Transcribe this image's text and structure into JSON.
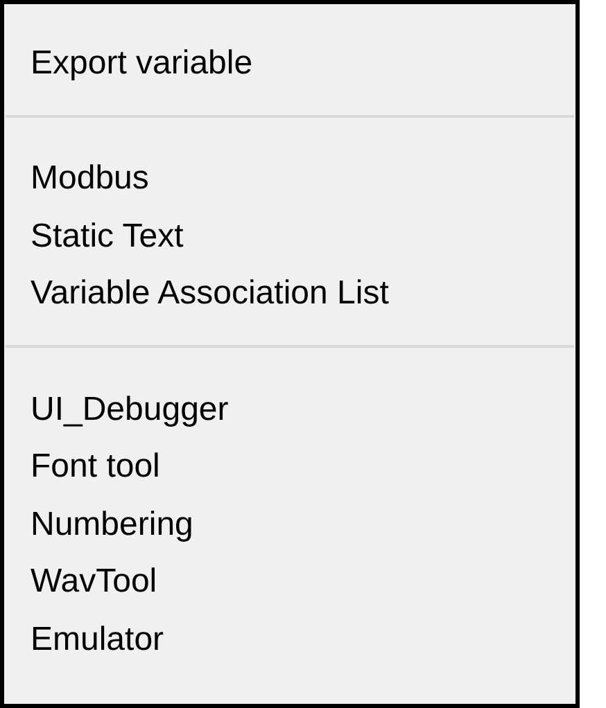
{
  "menu": {
    "groups": [
      {
        "items": [
          {
            "label": "Export variable"
          }
        ]
      },
      {
        "items": [
          {
            "label": "Modbus"
          },
          {
            "label": "Static Text"
          },
          {
            "label": "Variable Association List"
          }
        ]
      },
      {
        "items": [
          {
            "label": "UI_Debugger"
          },
          {
            "label": "Font tool"
          },
          {
            "label": "Numbering"
          },
          {
            "label": "WavTool"
          },
          {
            "label": "Emulator"
          }
        ]
      }
    ]
  }
}
